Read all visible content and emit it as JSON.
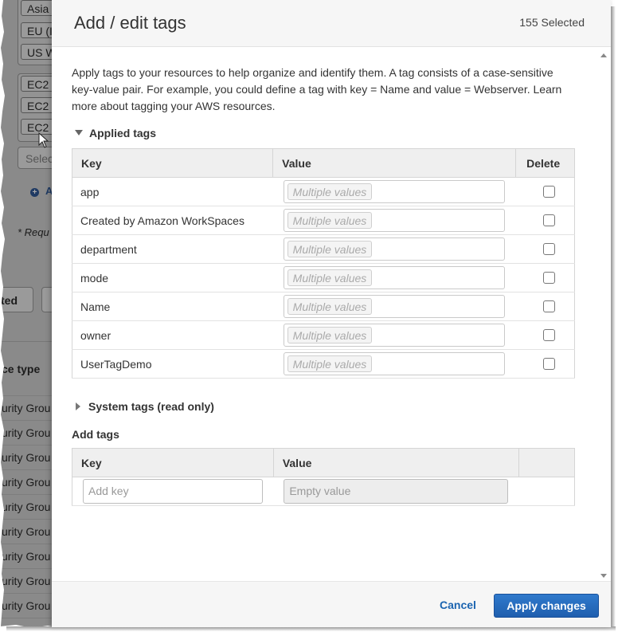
{
  "background": {
    "region_items": [
      "Asia",
      "EU (I",
      "US W"
    ],
    "type_items": [
      "EC2",
      "EC2",
      "EC2"
    ],
    "select_placeholder": "Selec",
    "add_label": "A",
    "required_note": "* Requ",
    "button_label": "ted",
    "column_header": "ce type",
    "row_text": "urity Grou",
    "row_count": 10
  },
  "modal": {
    "title": "Add / edit tags",
    "selected_count": "155 Selected",
    "description": "Apply tags to your resources to help organize and identify them. A tag consists of a case-sensitive key-value pair. For example, you could define a tag with key = Name and value = Webserver. Learn more about tagging your AWS resources.",
    "applied_tags": {
      "title": "Applied tags",
      "columns": {
        "key": "Key",
        "value": "Value",
        "delete": "Delete"
      },
      "rows": [
        {
          "key": "app",
          "value": "Multiple values"
        },
        {
          "key": "Created by Amazon WorkSpaces",
          "value": "Multiple values"
        },
        {
          "key": "department",
          "value": "Multiple values"
        },
        {
          "key": "mode",
          "value": "Multiple values"
        },
        {
          "key": "Name",
          "value": "Multiple values"
        },
        {
          "key": "owner",
          "value": "Multiple values"
        },
        {
          "key": "UserTagDemo",
          "value": "Multiple values"
        }
      ]
    },
    "system_tags": {
      "title": "System tags (read only)"
    },
    "add_tags": {
      "title": "Add tags",
      "columns": {
        "key": "Key",
        "value": "Value"
      },
      "key_placeholder": "Add key",
      "value_placeholder": "Empty value"
    },
    "footer": {
      "cancel": "Cancel",
      "apply": "Apply changes"
    }
  }
}
